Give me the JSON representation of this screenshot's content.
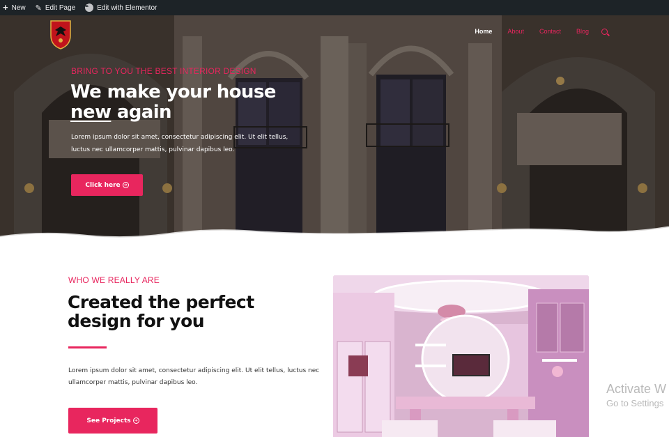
{
  "admin_bar": {
    "new_label": "New",
    "edit_page_label": "Edit Page",
    "elementor_label": "Edit with Elementor"
  },
  "nav": {
    "items": [
      {
        "label": "Home",
        "active": true
      },
      {
        "label": "About",
        "active": false
      },
      {
        "label": "Contact",
        "active": false
      },
      {
        "label": "Blog",
        "active": false
      }
    ]
  },
  "hero": {
    "subtitle": "BRING TO YOU THE BEST INTERIOR DESIGN",
    "title_line1": "We make your house",
    "title_underlined": "new",
    "title_line2_rest": " again",
    "text": "Lorem ipsum dolor sit amet, consectetur adipiscing elit. Ut elit tellus, luctus nec ullamcorper mattis, pulvinar dapibus leo.",
    "button_label": "Click here"
  },
  "about": {
    "subtitle": "WHO WE REALLY ARE",
    "title": "Created the perfect design for you",
    "text": "Lorem ipsum dolor sit amet, consectetur adipiscing elit. Ut elit tellus, luctus nec ullamcorper mattis, pulvinar dapibus leo.",
    "button_label": "See Projects"
  },
  "watermark": {
    "line1": "Activate W",
    "line2": "Go to Settings"
  },
  "colors": {
    "accent": "#e8265e",
    "admin_bar": "#1d2327"
  }
}
